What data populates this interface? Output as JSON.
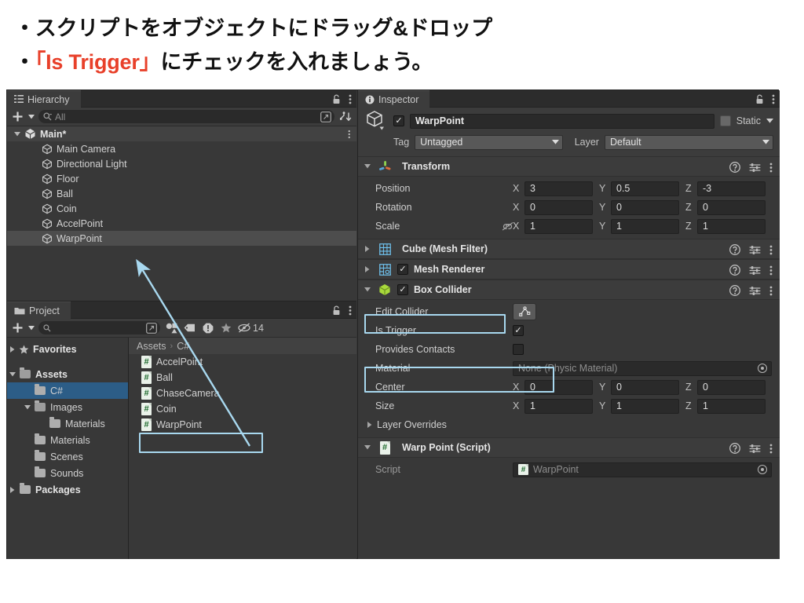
{
  "header": {
    "bullet1": "・スクリプトをオブジェクトにドラッグ&ドロップ",
    "bullet2_prefix": "・",
    "bullet2_accent": "「Is Trigger」",
    "bullet2_suffix": "にチェックを入れましょう。",
    "accent_color": "#e8402a"
  },
  "hierarchy": {
    "tab_label": "Hierarchy",
    "tab_icon": "hierarchy-list-icon",
    "lock_icon": "lock-icon",
    "menu_icon": "kebab-menu-icon",
    "toolbar": {
      "create_label": "+",
      "create_caret": "▼",
      "search_icon": "search-icon",
      "search_placeholder": "All",
      "search_value": "",
      "picker_icon": "window-picker-icon",
      "sort_icon": "sort-icon"
    },
    "items": [
      {
        "label": "Main*",
        "depth": 0,
        "expanded": true,
        "bold": true,
        "icon": "unity-scene-icon",
        "selected": false,
        "kebab": true
      },
      {
        "label": "Main Camera",
        "depth": 1,
        "icon": "gameobject-cube-icon",
        "selected": false
      },
      {
        "label": "Directional Light",
        "depth": 1,
        "icon": "gameobject-cube-icon",
        "selected": false
      },
      {
        "label": "Floor",
        "depth": 1,
        "icon": "gameobject-cube-icon",
        "selected": false
      },
      {
        "label": "Ball",
        "depth": 1,
        "icon": "gameobject-cube-icon",
        "selected": false
      },
      {
        "label": "Coin",
        "depth": 1,
        "icon": "gameobject-cube-icon",
        "selected": false
      },
      {
        "label": "AccelPoint",
        "depth": 1,
        "icon": "gameobject-cube-icon",
        "selected": false
      },
      {
        "label": "WarpPoint",
        "depth": 1,
        "icon": "gameobject-cube-icon",
        "selected": true
      }
    ]
  },
  "project": {
    "tab_label": "Project",
    "tab_icon": "folder-icon",
    "lock_icon": "lock-icon",
    "menu_icon": "kebab-menu-icon",
    "toolbar": {
      "create_label": "+",
      "create_caret": "▼",
      "search_icon": "search-icon",
      "search_value": "",
      "picker_icon": "window-picker-icon",
      "shapes_icon": "asset-type-filter-icon",
      "tag_icon": "label-filter-icon",
      "warning_icon": "warning-filter-icon",
      "star_icon": "favorites-filter-icon",
      "hidden_icon": "hidden-packages-icon",
      "hidden_count": "14"
    },
    "tree": [
      {
        "label": "Favorites",
        "depth": 0,
        "tri": "▶",
        "icon": "star-icon",
        "bold": true,
        "selected": false
      },
      {
        "label": "",
        "depth": 0,
        "spacer": true
      },
      {
        "label": "Assets",
        "depth": 0,
        "tri": "▼",
        "icon": "folder-open-icon",
        "bold": true,
        "selected": false
      },
      {
        "label": "C#",
        "depth": 1,
        "tri": "",
        "icon": "folder-icon",
        "bold": false,
        "selected": true
      },
      {
        "label": "Images",
        "depth": 1,
        "tri": "▼",
        "icon": "folder-open-icon",
        "bold": false,
        "selected": false
      },
      {
        "label": "Materials",
        "depth": 2,
        "tri": "",
        "icon": "folder-icon",
        "bold": false,
        "selected": false
      },
      {
        "label": "Materials",
        "depth": 1,
        "tri": "",
        "icon": "folder-icon",
        "bold": false,
        "selected": false
      },
      {
        "label": "Scenes",
        "depth": 1,
        "tri": "",
        "icon": "folder-icon",
        "bold": false,
        "selected": false
      },
      {
        "label": "Sounds",
        "depth": 1,
        "tri": "",
        "icon": "folder-icon",
        "bold": false,
        "selected": false
      },
      {
        "label": "Packages",
        "depth": 0,
        "tri": "▶",
        "icon": "folder-icon",
        "bold": true,
        "selected": false
      }
    ],
    "breadcrumb": {
      "root": "Assets",
      "separator": "›",
      "current": "C#"
    },
    "assets": [
      {
        "label": "AccelPoint",
        "icon": "csharp-script-icon",
        "highlighted": false
      },
      {
        "label": "Ball",
        "icon": "csharp-script-icon",
        "highlighted": false
      },
      {
        "label": "ChaseCamera",
        "icon": "csharp-script-icon",
        "highlighted": false
      },
      {
        "label": "Coin",
        "icon": "csharp-script-icon",
        "highlighted": false
      },
      {
        "label": "WarpPoint",
        "icon": "csharp-script-icon",
        "highlighted": true
      }
    ]
  },
  "inspector": {
    "tab_label": "Inspector",
    "tab_icon": "info-icon",
    "lock_icon": "lock-icon",
    "menu_icon": "kebab-menu-icon",
    "object": {
      "prefab_icon": "gameobject-cube-icon",
      "enabled": true,
      "name": "WarpPoint",
      "static_checked": false,
      "static_label": "Static",
      "static_caret": "▼",
      "tag_label": "Tag",
      "tag_value": "Untagged",
      "layer_label": "Layer",
      "layer_value": "Default"
    },
    "components": [
      {
        "name": "Transform",
        "icon": "transform-axis-icon",
        "expanded": true,
        "has_enable_checkbox": false,
        "help_icon": "help-icon",
        "preset_icon": "preset-icon",
        "menu_icon": "kebab-menu-icon",
        "rows": [
          {
            "type": "vector3",
            "label": "Position",
            "x": "3",
            "y": "0.5",
            "z": "-3"
          },
          {
            "type": "vector3",
            "label": "Rotation",
            "x": "0",
            "y": "0",
            "z": "0"
          },
          {
            "type": "vector3",
            "label": "Scale",
            "x": "1",
            "y": "1",
            "z": "1",
            "link_icon": "constrain-proportions-off-icon"
          }
        ]
      },
      {
        "name": "Cube (Mesh Filter)",
        "icon": "mesh-filter-icon",
        "expanded": false,
        "has_enable_checkbox": false,
        "rows": []
      },
      {
        "name": "Mesh Renderer",
        "icon": "mesh-renderer-icon",
        "expanded": false,
        "has_enable_checkbox": true,
        "enabled": true,
        "rows": []
      },
      {
        "name": "Box Collider",
        "icon": "box-collider-icon",
        "expanded": true,
        "has_enable_checkbox": true,
        "enabled": true,
        "highlighted": true,
        "rows": [
          {
            "type": "button",
            "label": "Edit Collider",
            "button_icon": "edit-collider-icon"
          },
          {
            "type": "checkbox",
            "label": "Is Trigger",
            "checked": true,
            "highlighted": true
          },
          {
            "type": "checkbox",
            "label": "Provides Contacts",
            "checked": false
          },
          {
            "type": "object",
            "label": "Material",
            "value": "None (Physic Material)",
            "dim": true
          },
          {
            "type": "vector3",
            "label": "Center",
            "x": "0",
            "y": "0",
            "z": "0"
          },
          {
            "type": "vector3",
            "label": "Size",
            "x": "1",
            "y": "1",
            "z": "1"
          },
          {
            "type": "foldout",
            "label": "Layer Overrides",
            "tri": "▶"
          }
        ]
      },
      {
        "name": "Warp Point (Script)",
        "icon": "csharp-script-icon",
        "expanded": true,
        "has_enable_checkbox": false,
        "rows": [
          {
            "type": "object",
            "label": "Script",
            "value": "WarpPoint",
            "dim": true,
            "value_icon": "csharp-script-icon",
            "label_dim": true
          }
        ]
      }
    ]
  },
  "annotations": {
    "arrow_color": "#a8d8ef",
    "highlight_color": "#a8d8ef",
    "arrow_from": "project-asset-warppoint",
    "arrow_to": "hierarchy-item-warppoint"
  }
}
